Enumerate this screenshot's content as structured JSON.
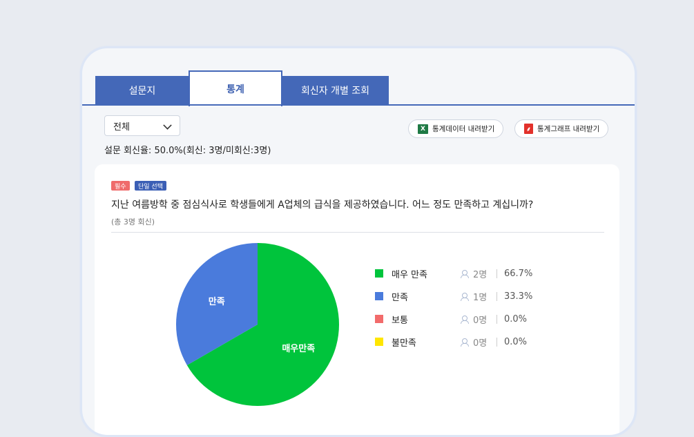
{
  "tabs": [
    {
      "label": "설문지",
      "active": false
    },
    {
      "label": "통계",
      "active": true
    },
    {
      "label": "회신자 개별 조회",
      "active": false
    }
  ],
  "filter": {
    "selected": "전체"
  },
  "toolbar": {
    "excel_label": "통계데이터 내려받기",
    "excel_icon": "excel-icon",
    "pdf_label": "통계그래프 내려받기",
    "pdf_icon": "pdf-icon"
  },
  "response_rate": "설문 회신율: 50.0%(회신: 3명/미회신:3명)",
  "question": {
    "required_badge": "필수",
    "type_badge": "단일 선택",
    "text": "지난 여름방학 중 점심식사로 학생들에게 A업체의 급식을 제공하였습니다. 어느 정도 만족하고 계십니까?",
    "respondents": "(총 3명 회신)"
  },
  "chart_data": {
    "type": "pie",
    "title": "",
    "slices": [
      {
        "label": "매우 만족",
        "pie_label": "매우만족",
        "count": 2,
        "count_text": "2명",
        "percent": 66.7,
        "percent_text": "66.7%",
        "color": "#00c43c"
      },
      {
        "label": "만족",
        "pie_label": "만족",
        "count": 1,
        "count_text": "1명",
        "percent": 33.3,
        "percent_text": "33.3%",
        "color": "#4a7bdc"
      },
      {
        "label": "보통",
        "pie_label": "",
        "count": 0,
        "count_text": "0명",
        "percent": 0.0,
        "percent_text": "0.0%",
        "color": "#f26b6b"
      },
      {
        "label": "불만족",
        "pie_label": "",
        "count": 0,
        "count_text": "0명",
        "percent": 0.0,
        "percent_text": "0.0%",
        "color": "#ffe600"
      }
    ],
    "legend": "right"
  }
}
